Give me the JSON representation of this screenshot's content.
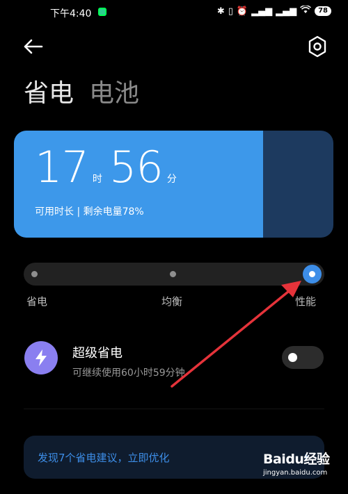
{
  "status_bar": {
    "time": "下午4:40",
    "icons": [
      "bluetooth-icon",
      "vibrate-icon",
      "alarm-icon",
      "hd-signal-icon",
      "hd-signal-icon",
      "wifi-icon"
    ],
    "battery": "78"
  },
  "header": {
    "back_icon": "arrow-left-icon",
    "settings_icon": "hexagon-gear-icon",
    "tab_active": "省电",
    "tab_inactive": "电池"
  },
  "battery_card": {
    "hours": "17",
    "hours_unit": "时",
    "minutes": "56",
    "minutes_unit": "分",
    "subtitle": "可用时长 | 剩余电量78%",
    "level_fraction": 0.78
  },
  "power_modes": {
    "options": [
      "省电",
      "均衡",
      "性能"
    ],
    "selected": "性能"
  },
  "ultra_saver": {
    "icon": "lightning-icon",
    "title": "超级省电",
    "subtitle": "可继续使用60小时59分钟",
    "enabled": false
  },
  "suggestions": {
    "text": "发现7个省电建议，立即优化",
    "icon": "chevron-right-icon"
  },
  "watermark": {
    "logo": "Baidu经验",
    "url": "jingyan.baidu.com"
  },
  "colors": {
    "accent": "#3d8ee8",
    "card_fill": "#3d98ea",
    "card_empty": "#1d3a5f",
    "ultra_icon_bg": "#8a7ff0",
    "annotation_arrow": "#e5333a"
  }
}
